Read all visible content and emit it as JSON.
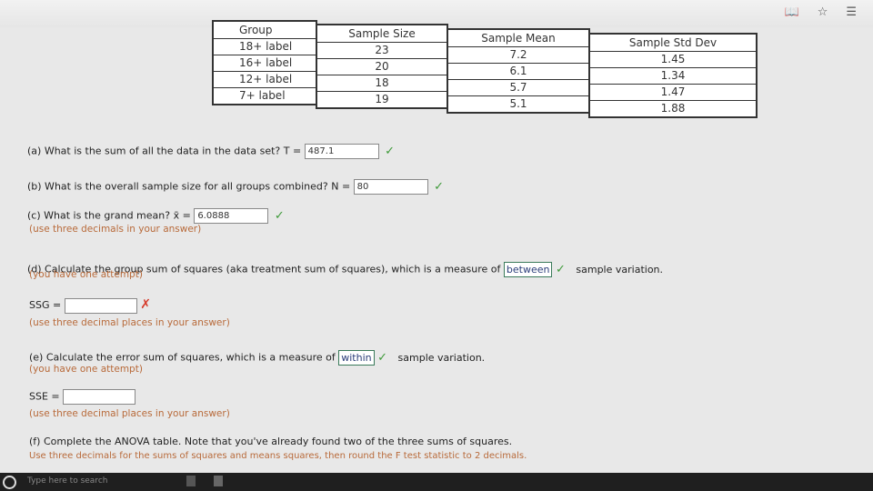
{
  "browser": {
    "top_icons": [
      "reading-view-icon",
      "favorite-star-icon",
      "favorites-list-icon"
    ]
  },
  "table": {
    "headers": [
      "Group",
      "Sample Size",
      "Sample Mean",
      "Sample Std Dev"
    ],
    "groups": [
      "18+ label",
      "16+ label",
      "12+ label",
      "7+ label"
    ],
    "sizes": [
      "23",
      "20",
      "18",
      "19"
    ],
    "means": [
      "7.2",
      "6.1",
      "5.7",
      "5.1"
    ],
    "stddevs": [
      "1.45",
      "1.34",
      "1.47",
      "1.88"
    ]
  },
  "questions": {
    "a": {
      "text": "(a) What is the sum of all the data in the data set? T =",
      "value": "487.1"
    },
    "b": {
      "text": "(b) What is the overall sample size for all groups combined? N =",
      "value": "80"
    },
    "c": {
      "text": "(c) What is the grand mean? x̄ =",
      "value": "6.0888",
      "note": "(use three decimals in your answer)"
    },
    "d": {
      "text": "(d) Calculate the group sum of squares (aka treatment sum of squares), which is a measure of",
      "selected": "between",
      "after": "sample variation.",
      "note": "(you have one attempt)"
    },
    "ssg": {
      "label": "SSG =",
      "value": "",
      "note": "(use three decimal places in your answer)"
    },
    "e": {
      "text": "(e) Calculate the error sum of squares, which is a measure of",
      "selected": "within",
      "after": "sample variation.",
      "note": "(you have one attempt)"
    },
    "sse": {
      "label": "SSE =",
      "value": "",
      "note": "(use three decimal places in your answer)"
    },
    "f": {
      "text": "(f) Complete the ANOVA table. Note that you've already found two of the three sums of squares.",
      "note": "Use three decimals for the sums of squares and means squares, then round the F test statistic to 2 decimals."
    }
  },
  "marks": {
    "correct": "✓",
    "wrong": "✗"
  },
  "taskbar": {
    "search_placeholder": "Type here to search"
  }
}
